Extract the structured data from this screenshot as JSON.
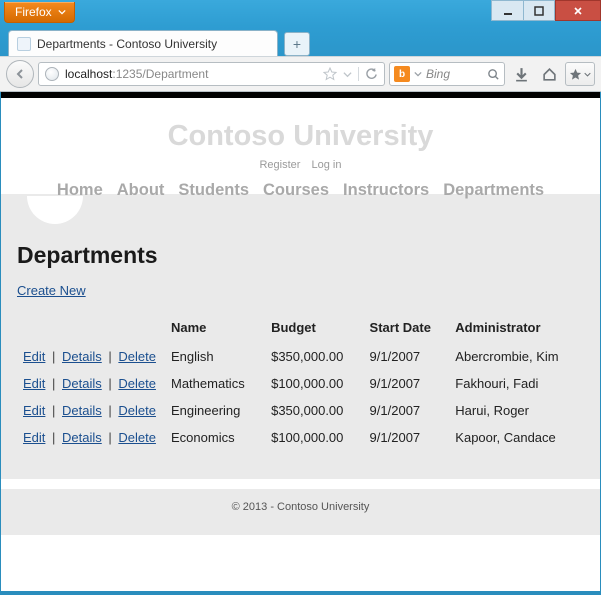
{
  "browser": {
    "ff_label": "Firefox",
    "tab_title": "Departments - Contoso University",
    "url_host": "localhost",
    "url_rest": ":1235/Department",
    "search_engine": "Bing",
    "search_icon_letter": "b"
  },
  "site": {
    "title": "Contoso University",
    "account_links": [
      "Register",
      "Log in"
    ],
    "nav": [
      "Home",
      "About",
      "Students",
      "Courses",
      "Instructors",
      "Departments"
    ],
    "footer": "© 2013 - Contoso University"
  },
  "page": {
    "heading": "Departments",
    "create_label": "Create New",
    "columns": [
      "Name",
      "Budget",
      "Start Date",
      "Administrator"
    ],
    "row_actions": [
      "Edit",
      "Details",
      "Delete"
    ],
    "rows": [
      {
        "name": "English",
        "budget": "$350,000.00",
        "start": "9/1/2007",
        "admin": "Abercrombie, Kim"
      },
      {
        "name": "Mathematics",
        "budget": "$100,000.00",
        "start": "9/1/2007",
        "admin": "Fakhouri, Fadi"
      },
      {
        "name": "Engineering",
        "budget": "$350,000.00",
        "start": "9/1/2007",
        "admin": "Harui, Roger"
      },
      {
        "name": "Economics",
        "budget": "$100,000.00",
        "start": "9/1/2007",
        "admin": "Kapoor, Candace"
      }
    ]
  }
}
